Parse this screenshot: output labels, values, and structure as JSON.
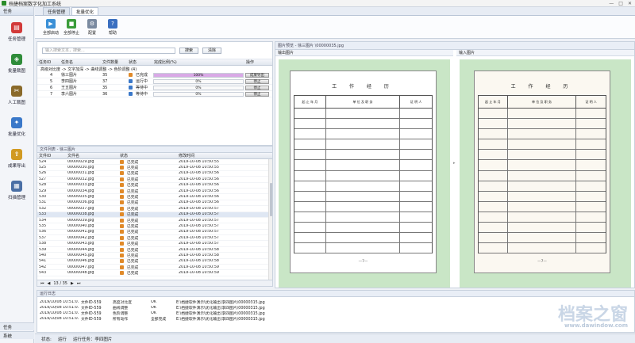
{
  "app": {
    "title": "档捷档案数字化加工系统",
    "window_controls": [
      "—",
      "□",
      "✕"
    ]
  },
  "leftnav": {
    "header": "任务",
    "items": [
      {
        "label": "任务管理",
        "color": "#d23a3a",
        "glyph": "▤"
      },
      {
        "label": "批量裁图",
        "color": "#2f8c3a",
        "glyph": "◈"
      },
      {
        "label": "人工裁图",
        "color": "#8a6a2a",
        "glyph": "✂"
      },
      {
        "label": "批量优化",
        "color": "#3a78c9",
        "glyph": "✦"
      },
      {
        "label": "成果导出",
        "color": "#d19a22",
        "glyph": "⇪"
      },
      {
        "label": "扫描管理",
        "color": "#4a6fa5",
        "glyph": "▦"
      }
    ],
    "footer_task": "任务",
    "footer_system": "系统"
  },
  "tabs": [
    {
      "label": "任务管理",
      "active": false
    },
    {
      "label": "批量优化",
      "active": true
    }
  ],
  "toolbar": [
    {
      "label": "全部启动",
      "color": "#3a8fd6",
      "glyph": "▶"
    },
    {
      "label": "全部停止",
      "color": "#3a9c3a",
      "glyph": "■"
    },
    {
      "label": "配置",
      "color": "#7a8aa0",
      "glyph": "⚙"
    },
    {
      "label": "帮助",
      "color": "#3a6fc0",
      "glyph": "?"
    }
  ],
  "search": {
    "placeholder": "输入搜索文本，搜索...",
    "search_btn": "搜索",
    "clear_btn": "清除"
  },
  "task_table": {
    "headers": [
      "任务ID",
      "任务名",
      "文件数量",
      "状态",
      "完成比例(%)",
      "操作"
    ],
    "group": "高级对比度 -> 文字加深 -> 曲线调整 -> 色阶调整 (4)",
    "rows": [
      {
        "id": "4",
        "name": "徐三图片",
        "count": "35",
        "status": "已完成",
        "pct": 100,
        "pct_text": "100%",
        "op": "成果导出",
        "status_color": "#e08a2a"
      },
      {
        "id": "5",
        "name": "李四图片",
        "count": "37",
        "status": "运行中",
        "pct": 0,
        "pct_text": "0%",
        "op": "停止",
        "status_color": "#3a78c9"
      },
      {
        "id": "6",
        "name": "王五图片",
        "count": "35",
        "status": "等待中",
        "pct": 0,
        "pct_text": "0%",
        "op": "停止",
        "status_color": "#3a78c9"
      },
      {
        "id": "7",
        "name": "李六图片",
        "count": "36",
        "status": "等待中",
        "pct": 0,
        "pct_text": "0%",
        "op": "停止",
        "status_color": "#3a78c9"
      }
    ]
  },
  "file_list": {
    "title": "文件列表 - 徐三图片",
    "headers": [
      "文件ID",
      "文件名",
      "状态",
      "修改时间"
    ],
    "rows": [
      {
        "id": "524",
        "name": "00000029.jpg",
        "status": "已完成",
        "time": "2019-10-08 10:50:55"
      },
      {
        "id": "525",
        "name": "00000030.jpg",
        "status": "已完成",
        "time": "2019-10-08 10:50:55"
      },
      {
        "id": "526",
        "name": "00000031.jpg",
        "status": "已完成",
        "time": "2019-10-08 10:50:56"
      },
      {
        "id": "527",
        "name": "00000032.jpg",
        "status": "已完成",
        "time": "2019-10-08 10:50:56"
      },
      {
        "id": "528",
        "name": "00000033.jpg",
        "status": "已完成",
        "time": "2019-10-08 10:50:56"
      },
      {
        "id": "529",
        "name": "00000034.jpg",
        "status": "已完成",
        "time": "2019-10-08 10:50:56"
      },
      {
        "id": "530",
        "name": "00000035.jpg",
        "status": "已完成",
        "time": "2019-10-08 10:50:56"
      },
      {
        "id": "531",
        "name": "00000036.jpg",
        "status": "已完成",
        "time": "2019-10-08 10:50:56"
      },
      {
        "id": "532",
        "name": "00000037.jpg",
        "status": "已完成",
        "time": "2019-10-08 10:50:57"
      },
      {
        "id": "533",
        "name": "00000038.jpg",
        "status": "已完成",
        "time": "2019-10-08 10:50:57"
      },
      {
        "id": "534",
        "name": "00000039.jpg",
        "status": "已完成",
        "time": "2019-10-08 10:50:57"
      },
      {
        "id": "535",
        "name": "00000040.jpg",
        "status": "已完成",
        "time": "2019-10-08 10:50:57"
      },
      {
        "id": "536",
        "name": "00000041.jpg",
        "status": "已完成",
        "time": "2019-10-08 10:50:57"
      },
      {
        "id": "537",
        "name": "00000042.jpg",
        "status": "已完成",
        "time": "2019-10-08 10:50:57"
      },
      {
        "id": "538",
        "name": "00000043.jpg",
        "status": "已完成",
        "time": "2019-10-08 10:50:57"
      },
      {
        "id": "539",
        "name": "00000044.jpg",
        "status": "已完成",
        "time": "2019-10-08 10:50:58"
      },
      {
        "id": "540",
        "name": "00000045.jpg",
        "status": "已完成",
        "time": "2019-10-08 10:50:58"
      },
      {
        "id": "541",
        "name": "00000046.jpg",
        "status": "已完成",
        "time": "2019-10-08 10:50:58"
      },
      {
        "id": "542",
        "name": "00000047.jpg",
        "status": "已完成",
        "time": "2019-10-08 10:50:59"
      },
      {
        "id": "543",
        "name": "00000048.jpg",
        "status": "已完成",
        "time": "2019-10-08 10:50:59"
      }
    ],
    "pager": "13 / 35"
  },
  "preview": {
    "title": "图片预览 - 徐三图片 \\00000035.jpg",
    "output_label": "输出图片",
    "input_label": "输入图片",
    "doc": {
      "heading": "工 作 经 历",
      "col1": "起 止 年 月",
      "col2": "单 位 及 职 务",
      "col3": "证 明 人",
      "page_num": "—7—"
    }
  },
  "log": {
    "title": "运行日志",
    "rows": [
      {
        "time": "2019/10/08 10:51:01",
        "file": "文件ID-559",
        "action": "高度对比度",
        "result": "OK",
        "path": "E:\\档捷软件演示\\优化输出\\李四图片\\00000315.jpg"
      },
      {
        "time": "2019/10/08 10:51:01",
        "file": "文件ID-559",
        "action": "曲线调整",
        "result": "OK",
        "path": "E:\\档捷软件演示\\优化输出\\李四图片\\00000315.jpg"
      },
      {
        "time": "2019/10/08 10:51:01",
        "file": "文件ID-559",
        "action": "色阶调整",
        "result": "OK",
        "path": "E:\\档捷软件演示\\优化输出\\李四图片\\00000315.jpg"
      },
      {
        "time": "2019/10/08 10:51:01",
        "file": "文件ID-559",
        "action": "所有动作",
        "result": "全部完成",
        "path": "E:\\档捷软件演示\\优化输出\\李四图片\\00000315.jpg"
      }
    ]
  },
  "status": {
    "label": "状态:",
    "state": "运行",
    "task": "运行任务：李四图片"
  },
  "watermark": {
    "brand": "档案之窗",
    "url": "www.dawindow.com"
  }
}
